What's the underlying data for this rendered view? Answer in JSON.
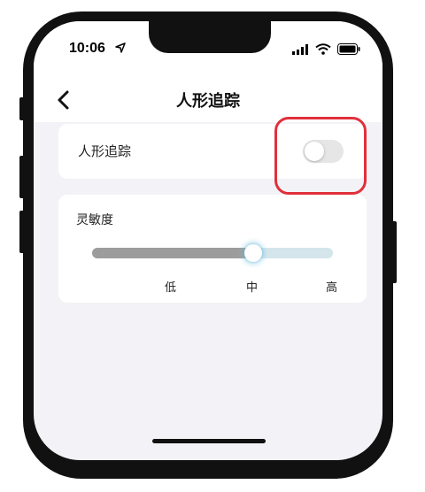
{
  "status_bar": {
    "time": "10:06"
  },
  "nav": {
    "title": "人形追踪"
  },
  "tracking": {
    "label": "人形追踪",
    "toggle_on": false
  },
  "sensitivity": {
    "label": "灵敏度",
    "value_fraction": 0.67,
    "ticks": [
      "低",
      "中",
      "高"
    ]
  },
  "colors": {
    "highlight_border": "#e0303b",
    "slider_filled": "#9c9c9c",
    "slider_unfilled": "#d4e6ec",
    "toggle_off_bg": "#e6e6e6"
  }
}
